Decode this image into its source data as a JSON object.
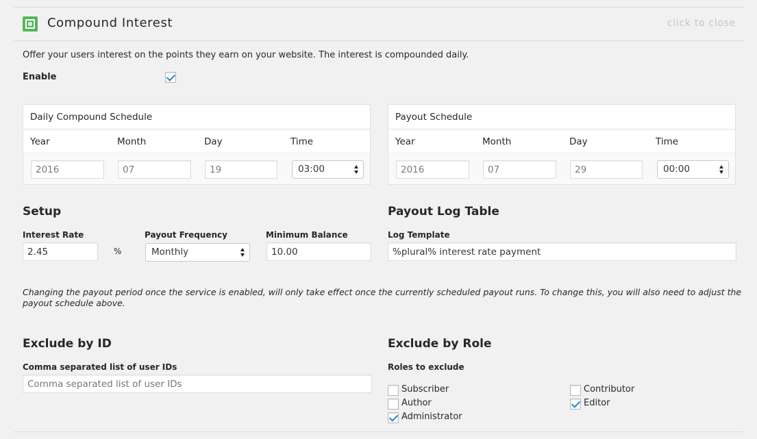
{
  "header": {
    "title": "Compound Interest",
    "close_label": "click to close",
    "icon": "safe-icon",
    "icon_color": "#55b55a"
  },
  "description": "Offer your users interest on the points they earn on your website. The interest is compounded daily.",
  "enable": {
    "label": "Enable",
    "checked": true
  },
  "daily_schedule": {
    "title": "Daily Compound Schedule",
    "columns": [
      "Year",
      "Month",
      "Day",
      "Time"
    ],
    "year": "2016",
    "month": "07",
    "day": "19",
    "time": "03:00"
  },
  "payout_schedule": {
    "title": "Payout Schedule",
    "columns": [
      "Year",
      "Month",
      "Day",
      "Time"
    ],
    "year": "2016",
    "month": "07",
    "day": "29",
    "time": "00:00"
  },
  "setup": {
    "heading": "Setup",
    "interest_rate_label": "Interest Rate",
    "interest_rate_value": "2.45",
    "percent_symbol": "%",
    "payout_frequency_label": "Payout Frequency",
    "payout_frequency_value": "Monthly",
    "minimum_balance_label": "Minimum Balance",
    "minimum_balance_value": "10.00"
  },
  "payout_log": {
    "heading": "Payout Log Table",
    "log_template_label": "Log Template",
    "log_template_value": "%plural% interest rate payment"
  },
  "note": "Changing the payout period once the service is enabled, will only take effect once the currently scheduled payout runs. To change this, you will also need to adjust the payout schedule above.",
  "exclude_id": {
    "heading": "Exclude by ID",
    "label": "Comma separated list of user IDs",
    "placeholder": "Comma separated list of user IDs"
  },
  "exclude_role": {
    "heading": "Exclude by Role",
    "label": "Roles to exclude",
    "roles": [
      {
        "name": "Subscriber",
        "checked": false
      },
      {
        "name": "Contributor",
        "checked": false
      },
      {
        "name": "Author",
        "checked": false
      },
      {
        "name": "Editor",
        "checked": true
      },
      {
        "name": "Administrator",
        "checked": true
      }
    ]
  },
  "colors": {
    "checkmark": "#1e8cbe",
    "background": "#f1f1f1"
  }
}
